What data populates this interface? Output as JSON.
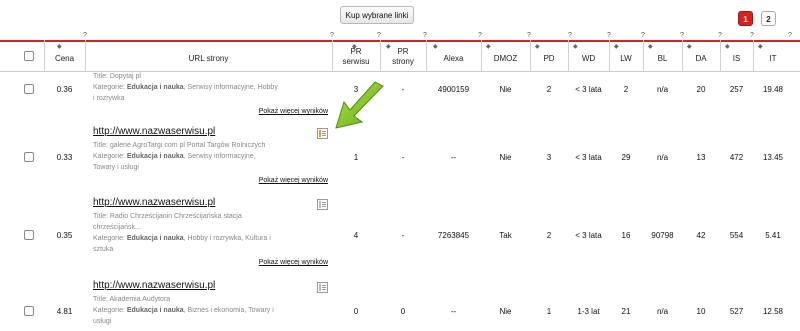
{
  "toolbar": {
    "buy_label": "Kup wybrane linki"
  },
  "pagination": {
    "pages": [
      "1",
      "2"
    ],
    "active": "1"
  },
  "hint_marker": "?",
  "columns": [
    "Cena",
    "URL strony",
    "PR serwisu",
    "PR strony",
    "Alexa",
    "DMOZ",
    "PD",
    "WD",
    "LW",
    "BL",
    "DA",
    "IS",
    "IT"
  ],
  "rows": [
    {
      "url": "",
      "title": "Title: Dopytaj pl",
      "category_label": "Kategorie: ",
      "category_main": "Edukacja i nauka",
      "category_rest": ", Serwisy informacyjne, Hobby",
      "category_rest2": "i rozrywka",
      "more": "Pokaż więcej wyników",
      "price": "0.36",
      "pr_site": "3",
      "pr_page": "-",
      "alexa": "4900159",
      "dmoz": "Nie",
      "pd": "2",
      "wd": "< 3 lata",
      "lw": "2",
      "bl": "n/a",
      "da": "20",
      "is": "257",
      "it": "19.48"
    },
    {
      "url": "http://www.nazwaserwisu.pl",
      "title": "Title: galerie AgroTargi com pl Portal Targów Rolniczych",
      "category_label": "Kategorie: ",
      "category_main": "Edukacja i nauka",
      "category_rest": ", Serwisy informacyjne,",
      "category_rest2": "Towary i usługi",
      "more": "Pokaż więcej wyników",
      "price": "0.33",
      "pr_site": "1",
      "pr_page": "-",
      "alexa": "--",
      "dmoz": "Nie",
      "pd": "3",
      "wd": "< 3 lata",
      "lw": "29",
      "bl": "n/a",
      "da": "13",
      "is": "472",
      "it": "13.45"
    },
    {
      "url": "http://www.nazwaserwisu.pl",
      "title": "Title: Radio Chrześcijanin Chrześcijańska stacja",
      "title2": "chrześcijańsk...",
      "category_label": "Kategorie: ",
      "category_main": "Edukacja i nauka",
      "category_rest": ", Hobby i rozrywka, Kultura i",
      "category_rest2": "sztuka",
      "more": "Pokaż więcej wyników",
      "price": "0.35",
      "pr_site": "4",
      "pr_page": "-",
      "alexa": "7263845",
      "dmoz": "Tak",
      "pd": "2",
      "wd": "< 3 lata",
      "lw": "16",
      "bl": "90798",
      "da": "42",
      "is": "554",
      "it": "5.41"
    },
    {
      "url": "http://www.nazwaserwisu.pl",
      "title": "Title: Akademia Audytora",
      "category_label": "Kategorie: ",
      "category_main": "Edukacja i nauka",
      "category_rest": ", Biznes i ekonomia, Towary i",
      "category_rest2": "usługi",
      "price": "4.81",
      "pr_site": "0",
      "pr_page": "0",
      "alexa": "--",
      "dmoz": "Nie",
      "pd": "1",
      "wd": "1-3 lat",
      "lw": "21",
      "bl": "n/a",
      "da": "10",
      "is": "527",
      "it": "12.58"
    }
  ],
  "colors": {
    "accent": "#d9211e",
    "arrow": "#7ec21c"
  }
}
